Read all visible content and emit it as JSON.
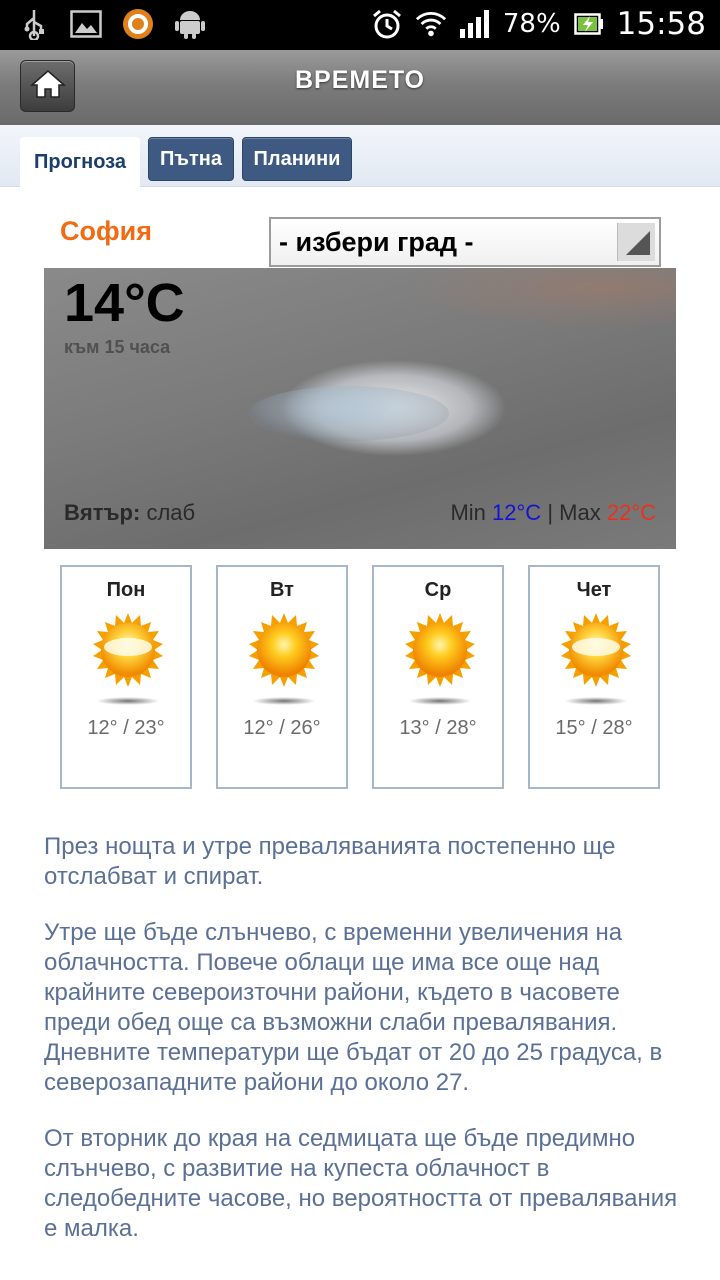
{
  "status_bar": {
    "left_icons": [
      "usb-icon",
      "image-icon",
      "browser-icon",
      "android-icon"
    ],
    "right_icons": [
      "alarm-icon",
      "wifi-icon",
      "signal-icon",
      "battery-charging-icon"
    ],
    "battery": "78%",
    "time": "15:58"
  },
  "header": {
    "title": "ВРЕМЕТО",
    "home_icon": "home-icon"
  },
  "tabs": [
    {
      "label": "Прогноза",
      "active": true
    },
    {
      "label": "Пътна",
      "active": false
    },
    {
      "label": "Планини",
      "active": false
    }
  ],
  "city": {
    "name": "София",
    "select_label": "- избери град -"
  },
  "current": {
    "temp": "14°C",
    "subtitle": "към 15 часа",
    "wind_label": "Вятър:",
    "wind_value": "слаб",
    "min_label": "Min",
    "min_value": "12°C",
    "separator": "|",
    "max_label": "Max",
    "max_value": "22°C",
    "icon": "cloud-icon",
    "colors": {
      "min": "#1414d2",
      "max": "#e8321e",
      "city": "#f26a12"
    }
  },
  "days": [
    {
      "name": "Пон",
      "temps": "12° / 23°",
      "icon": "sun-haze-icon"
    },
    {
      "name": "Вт",
      "temps": "12° / 26°",
      "icon": "sun-icon"
    },
    {
      "name": "Ср",
      "temps": "13° / 28°",
      "icon": "sun-icon"
    },
    {
      "name": "Чет",
      "temps": "15° / 28°",
      "icon": "sun-haze-icon"
    }
  ],
  "text": {
    "p1": "През нощта и утре преваляванията постепенно ще отслабват и спират.",
    "p2": "Утре ще бъде слънчево, с временни увеличения на облачността. Повече облаци ще има все още над крайните североизточни райони, където  в часовете преди обед още са възможни слаби превалявания. Дневните температури ще бъдат от 20 до 25 градуса, в северозападните райони до около 27.",
    "p3": "От вторник до края на седмицата ще бъде предимно слънчево, с развитие на купеста облачност в следобедните часове, но вероятността от превалявания е малка."
  }
}
